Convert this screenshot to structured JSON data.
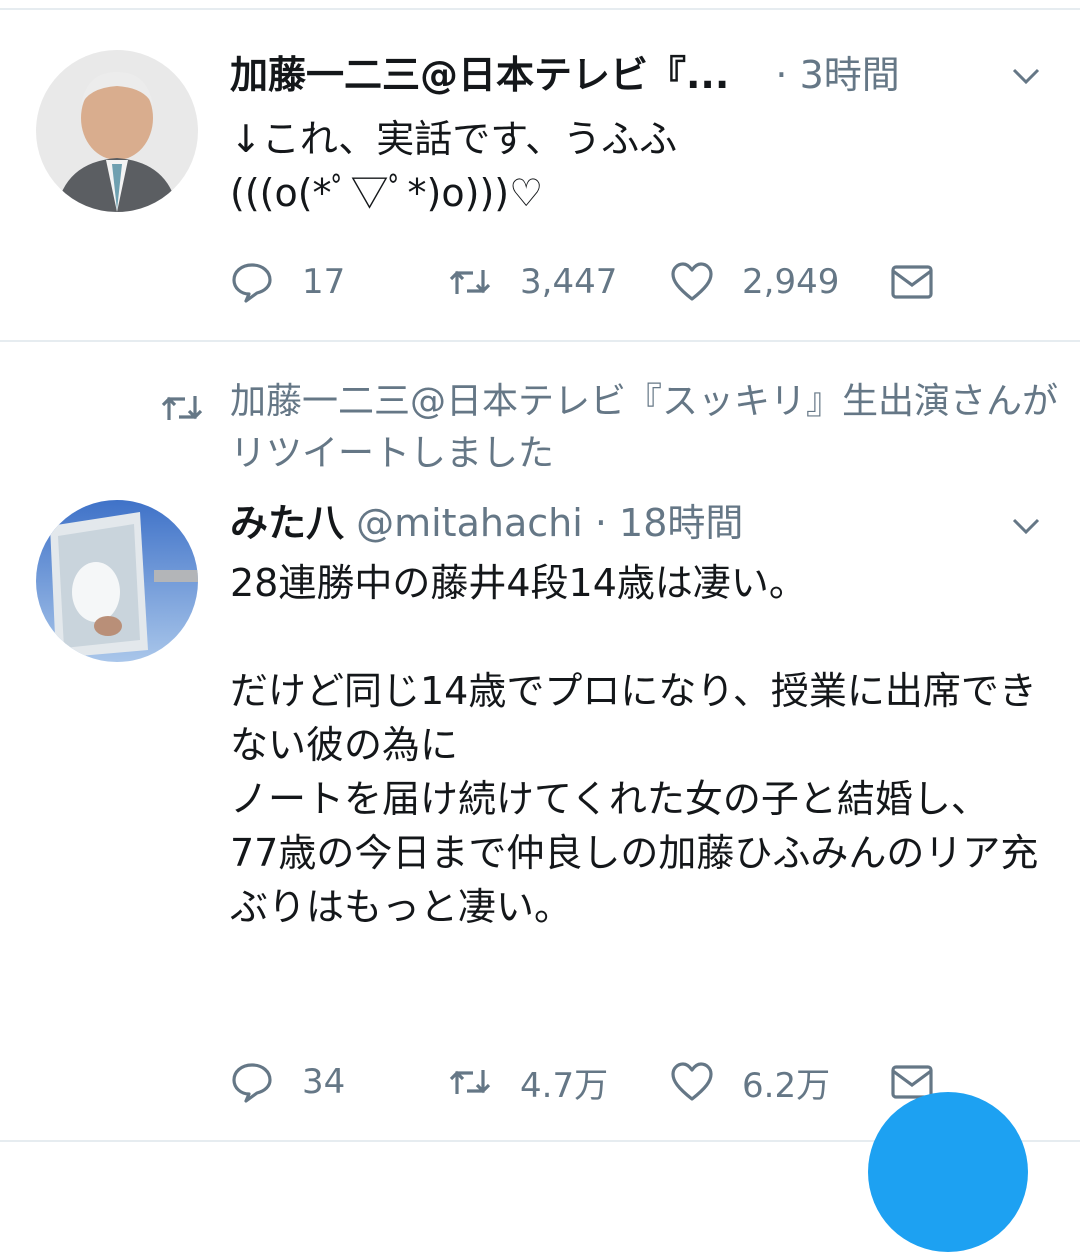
{
  "tweets": [
    {
      "name": "加藤一二三@日本テレビ『...",
      "time": "3時間",
      "text": "↓これ、実話です、うふふ\n(((o(*ﾟ▽ﾟ*)o)))♡",
      "replies": "17",
      "retweets": "3,447",
      "likes": "2,949"
    },
    {
      "retweet_context": "加藤一二三@日本テレビ『スッキリ』生出演さんがリツイートしました",
      "name": "みた八",
      "handle": "@mitahachi",
      "time": "18時間",
      "text": "28連勝中の藤井4段14歳は凄い。\n\nだけど同じ14歳でプロになり、授業に出席できない彼の為に\nノートを届け続けてくれた女の子と結婚し、\n77歳の今日まで仲良しの加藤ひふみんのリア充ぶりはもっと凄い。",
      "replies": "34",
      "retweets": "4.7万",
      "likes": "6.2万"
    }
  ],
  "colors": {
    "accent": "#1da1f2",
    "secondary_text": "#657786",
    "divider": "#e6ecf0"
  },
  "icons": [
    "reply-icon",
    "retweet-icon",
    "like-icon",
    "dm-icon",
    "chevron-down-icon",
    "compose-fab"
  ]
}
